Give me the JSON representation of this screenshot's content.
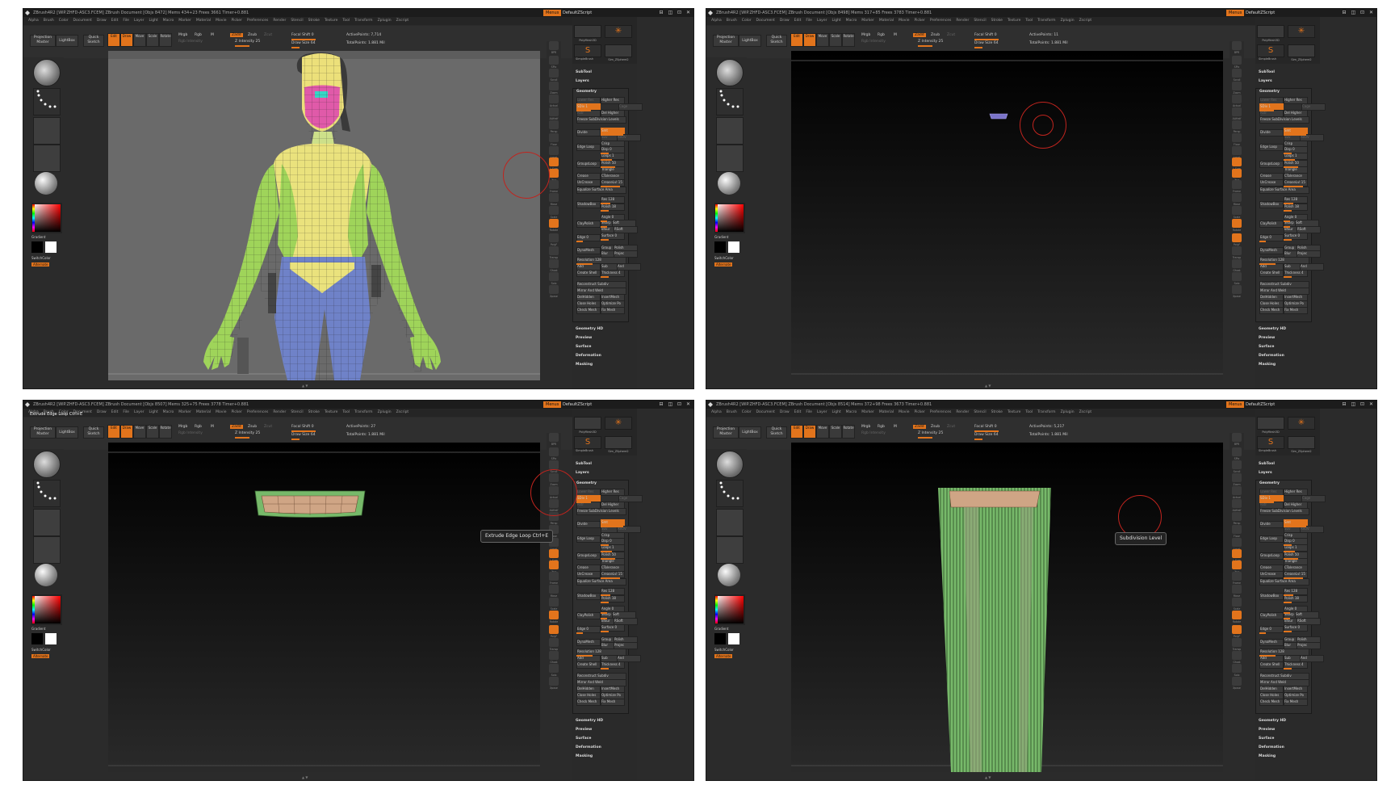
{
  "common": {
    "menu_button": "Menus",
    "script_label": "DefaultZScript",
    "window_buttons": "⊟ ◫ ⊡ ✕",
    "menu_items": [
      "Alpha",
      "Brush",
      "Color",
      "Document",
      "Draw",
      "Edit",
      "File",
      "Layer",
      "Light",
      "Macro",
      "Marker",
      "Material",
      "Movie",
      "Picker",
      "Preferences",
      "Render",
      "Stencil",
      "Stroke",
      "Texture",
      "Tool",
      "Transform",
      "Zplugin",
      "Zscript"
    ],
    "toolbar": {
      "projection_master": "Projection Master",
      "lightbox": "LightBox",
      "quick_sketch": "Quick Sketch",
      "edit": "Edit",
      "draw": "Draw",
      "move": "Move",
      "scale": "Scale",
      "rotate": "Rotate",
      "mrgb": "Mrgb",
      "rgb": "Rgb",
      "m": "M",
      "zadd": "Zadd",
      "zsub": "Zsub",
      "zcut": "Zcut",
      "rgb_intensity": "Rgb Intensity",
      "z_intensity": "Z Intensity 25",
      "focal_shift": "Focal Shift 0",
      "draw_size": "Draw Size 64",
      "total_points": "TotalPoints: 1.881 Mil"
    },
    "left_labels": {
      "standard": "Standard",
      "dots": "Dots",
      "alpha_off": "Alpha Off",
      "texture_off": "Texture Off",
      "gradient": "Gradient",
      "switch_color": "SwitchColor",
      "alternate": "Alternate"
    },
    "shelf_labels": [
      "BPR",
      "SPix",
      "Scroll",
      "Zoom",
      "Actual",
      "AAHalf",
      "Persp",
      "Floor",
      "Local",
      "L.Sym",
      "Xyz",
      "Frame",
      "Move",
      "Scale",
      "Rotate",
      "PolyF",
      "Transp",
      "Ghost",
      "Solo",
      "Xpose"
    ],
    "tool_icons": [
      "PolyMesh3D",
      "SimpleBrush",
      "Sim_ZSphere2"
    ],
    "right_sections": [
      "SubTool",
      "Layers",
      "Geometry",
      "Geometry HD",
      "Preview",
      "Surface",
      "Deformation",
      "Masking"
    ],
    "geometry": {
      "lower_res": "Lower Res",
      "higher_res": "Higher Res",
      "sdiv": "SDiv 1",
      "cage": "Cage",
      "rstr": "Rstr",
      "del_lower": "Del Lower",
      "del_higher": "Del Higher",
      "freeze": "Freeze SubDivision Levels",
      "reconstruct": "Reconstruct Subdiv",
      "convert_bpr": "Convert BPR To Geo",
      "divide": "Divide",
      "smt": "Smt",
      "suv": "Suv",
      "reuv": "ReUV",
      "edge_loop": "Edge Loop",
      "crisp": "Crisp",
      "disp": "Disp 0",
      "loops": "Loops 1",
      "groups_loop": "GroupsLoop",
      "polish": "Polish 50",
      "triangle": "Triangle",
      "crease": "Crease",
      "crease_tol": "CTolerance",
      "uncrease": "UnCrease",
      "crease_lvl": "CreaseLvl 15",
      "equalize": "Equalize Surface Area",
      "shadow_box": "ShadowBox",
      "res": "Res 128",
      "polish2": "Polish 18",
      "clay_polish": "ClayPolish",
      "angle": "Angle 0",
      "sharp": "Sharp",
      "soft": "Soft",
      "bl": "BlSur",
      "rsoft": "RSoft",
      "edge": "Edge 0",
      "surface": "Surface 0",
      "dyna_mesh": "DynaMesh",
      "group": "Group",
      "polish3": "Polish",
      "blur": "Blur",
      "projec": "Projec",
      "resolution": "Resolution 128",
      "add": "Add",
      "sub": "Sub",
      "and": "And",
      "create_shell": "Create Shell",
      "thickness": "Thickness 4",
      "mirror": "Mirror And Weld",
      "delhidden": "DelHidden",
      "insertmesh": "InsertMesh",
      "close_holes": "Close Holes",
      "optimize": "Optimize Po",
      "check_mesh": "Check Mesh",
      "fix_mesh": "Fix Mesh"
    }
  },
  "panels": [
    {
      "title": "ZBrush4R2 [WIP.ZHFD-ASC3.FCEM]   ZBrush Document   [Objs 8472] Mems 434+23 Frees 3661 Timer+0.881",
      "status_line": "",
      "active_points": "ActivePoints: 7,714",
      "tooltip": ""
    },
    {
      "title": "ZBrush4R2 [WIP.ZHFD-ASC3.FCEM]   ZBrush Document   [Objs 8498] Mems 317+85 Frees 3783 Timer+0.881",
      "status_line": "",
      "active_points": "ActivePoints: 11",
      "tooltip": ""
    },
    {
      "title": "ZBrush4R2 [WIP.ZHFD-ASC3.FCEM]   ZBrush Document   [Objs 8507] Mems 325+75 Frees 3778 Timer+0.881",
      "status_line": "Extrude Edge Loop  Ctrl+E",
      "active_points": "ActivePoints: 27",
      "tooltip": "Extrude Edge Loop   Ctrl+E"
    },
    {
      "title": "ZBrush4R2 [WIP.ZHFD-ASC3.FCEM]   ZBrush Document   [Objs 8514] Mems 372+98 Frees 3673 Timer+0.881",
      "status_line": "",
      "active_points": "ActivePoints: 5,217",
      "tooltip": "Subdivision Level"
    }
  ],
  "colors": {
    "accent": "#e2741c",
    "panel_bg": "#2b2b2b",
    "brush_circle": "#c0241e"
  }
}
